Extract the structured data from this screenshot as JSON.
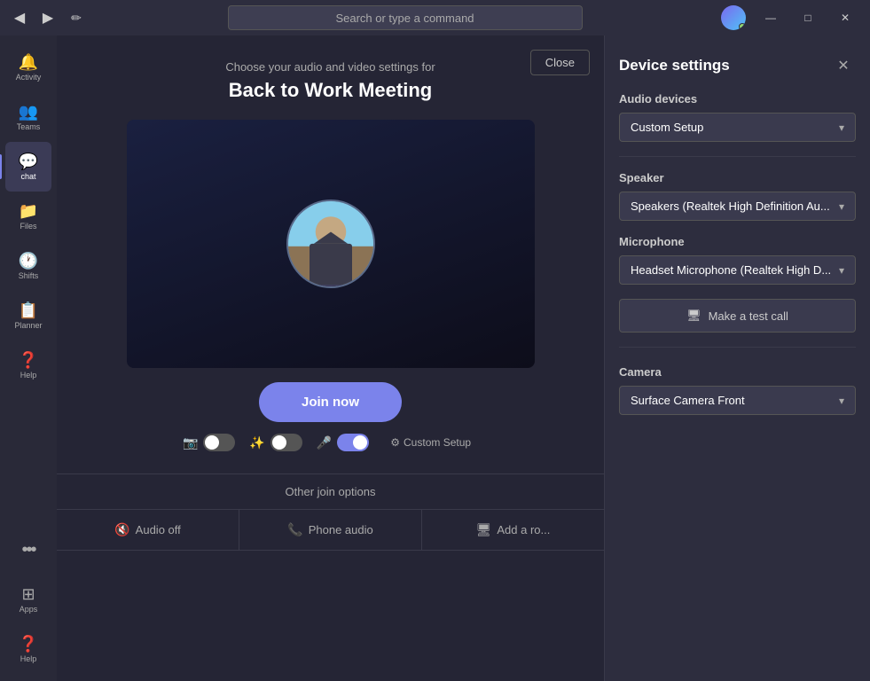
{
  "titlebar": {
    "search_placeholder": "Search or type a command",
    "back_label": "◀",
    "forward_label": "▶",
    "edit_label": "✏",
    "minimize": "—",
    "maximize": "□",
    "close": "✕"
  },
  "sidebar": {
    "items": [
      {
        "id": "activity",
        "label": "Activity",
        "icon": "🔔"
      },
      {
        "id": "teams",
        "label": "Teams",
        "icon": "👥"
      },
      {
        "id": "chat",
        "label": "chat",
        "icon": "💬",
        "active": true
      },
      {
        "id": "files",
        "label": "Files",
        "icon": "📁"
      },
      {
        "id": "shifts",
        "label": "Shifts",
        "icon": "🕐"
      },
      {
        "id": "planner",
        "label": "Planner",
        "icon": "📋"
      },
      {
        "id": "help",
        "label": "Help",
        "icon": "❓"
      }
    ],
    "bottom_items": [
      {
        "id": "apps",
        "label": "Apps",
        "icon": "⊞"
      },
      {
        "id": "help2",
        "label": "Help",
        "icon": "❓"
      }
    ],
    "more_label": "...",
    "more_icon": "···"
  },
  "meeting": {
    "close_label": "Close",
    "subtitle": "Choose your audio and video settings for",
    "title": "Back to Work Meeting",
    "join_label": "Join now",
    "controls": {
      "video_toggle_on": false,
      "blur_toggle_on": false,
      "mic_toggle_on": true,
      "custom_setup_label": "Custom Setup",
      "custom_setup_icon": "⚙"
    },
    "other_options": {
      "title": "Other join options",
      "items": [
        {
          "id": "audio-off",
          "label": "Audio off",
          "icon": "🔇"
        },
        {
          "id": "phone-audio",
          "label": "Phone audio",
          "icon": "📞"
        },
        {
          "id": "add-room",
          "label": "Add a ro...",
          "icon": "🖥"
        }
      ]
    }
  },
  "device_settings": {
    "title": "Device settings",
    "close_icon": "✕",
    "audio_devices_label": "Audio devices",
    "audio_device_value": "Custom Setup",
    "speaker_label": "Speaker",
    "speaker_value": "Speakers (Realtek High Definition Au...",
    "microphone_label": "Microphone",
    "microphone_value": "Headset Microphone (Realtek High D...",
    "test_call_icon": "🖥",
    "test_call_label": "Make a test call",
    "camera_label": "Camera",
    "camera_value": "Surface Camera Front",
    "chevron": "▾"
  }
}
